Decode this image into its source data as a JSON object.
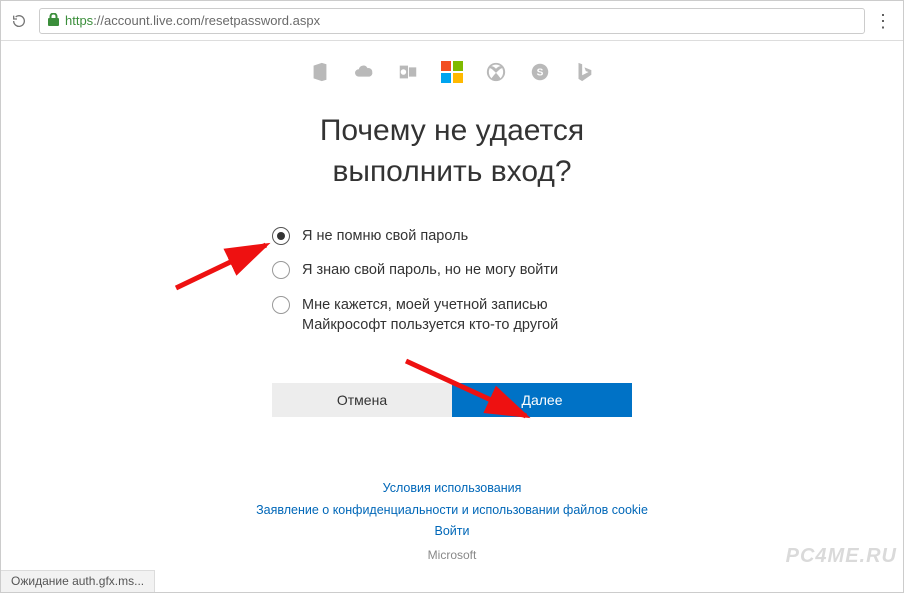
{
  "browser": {
    "url_secure": "https",
    "url_rest": "://account.live.com/resetpassword.aspx",
    "status": "Ожидание auth.gfx.ms..."
  },
  "icons": {
    "office": "office-icon",
    "onedrive": "onedrive-icon",
    "outlook": "outlook-icon",
    "microsoft": "microsoft-logo",
    "xbox": "xbox-icon",
    "skype": "skype-icon",
    "bing": "bing-icon"
  },
  "heading_line1": "Почему не удается",
  "heading_line2": "выполнить вход?",
  "options": [
    {
      "label": "Я не помню свой пароль",
      "selected": true
    },
    {
      "label": "Я знаю свой пароль, но не могу войти",
      "selected": false
    },
    {
      "label": "Мне кажется, моей учетной записью Майкрософт пользуется кто-то другой",
      "selected": false
    }
  ],
  "buttons": {
    "cancel": "Отмена",
    "next": "Далее"
  },
  "footer": {
    "terms": "Условия использования",
    "privacy": "Заявление о конфиденциальности и использовании файлов cookie",
    "signin": "Войти",
    "brand": "Microsoft"
  },
  "watermark": "PC4ME.RU"
}
